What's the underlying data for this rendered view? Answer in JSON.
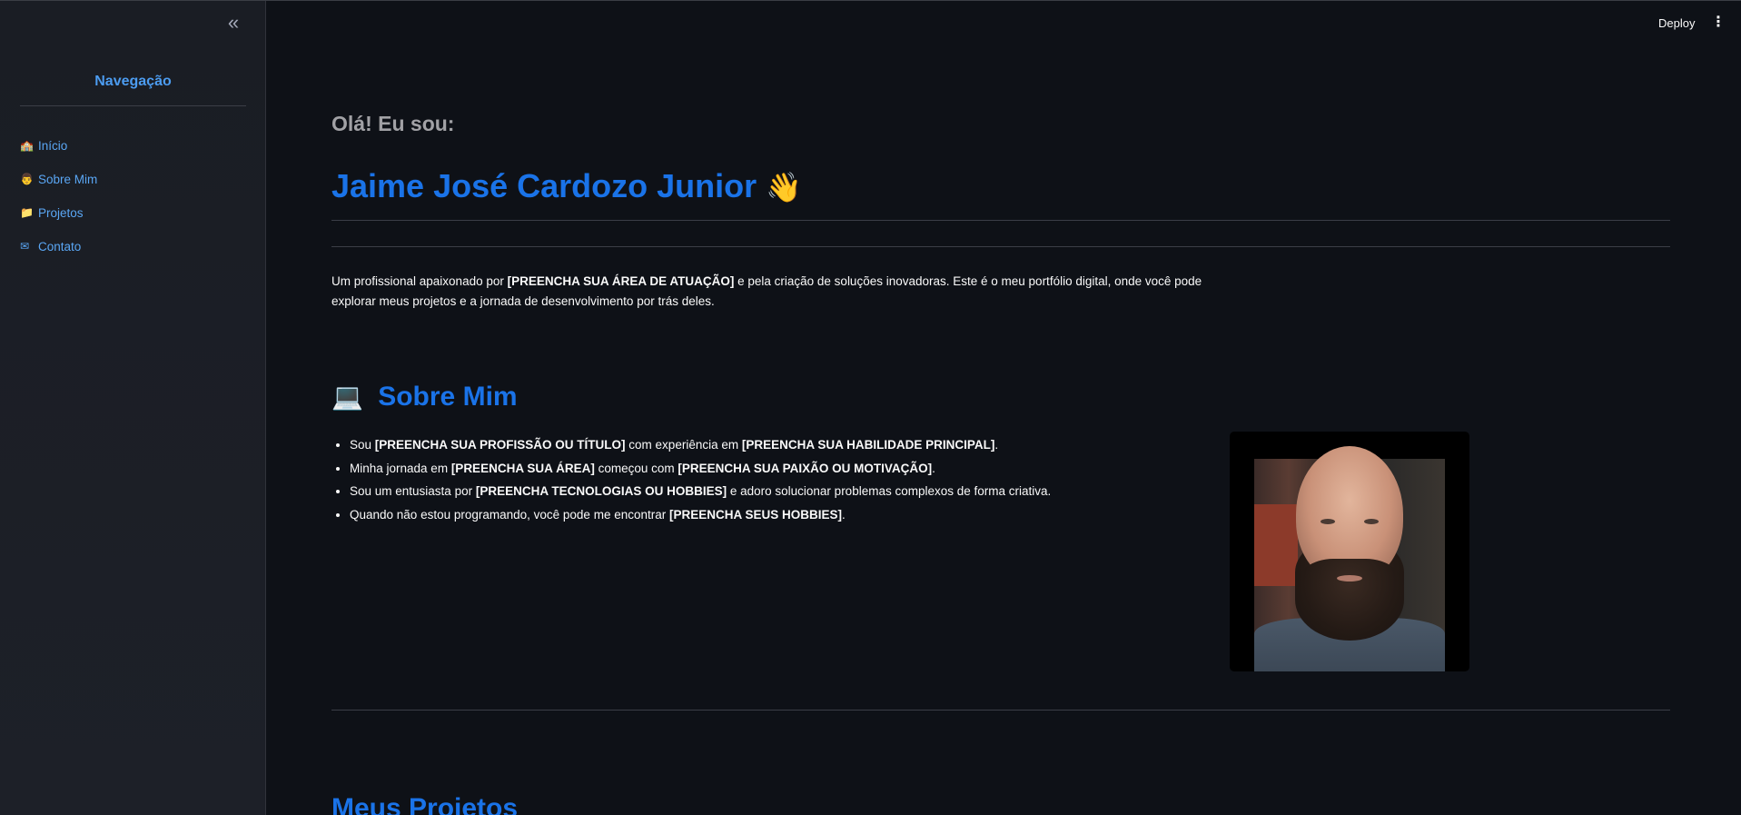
{
  "sidebar": {
    "collapse_icon": "«",
    "title": "Navegação",
    "items": [
      {
        "icon": "🏫",
        "label": "Início"
      },
      {
        "icon": "👨",
        "label": "Sobre Mim"
      },
      {
        "icon": "📁",
        "label": "Projetos"
      },
      {
        "icon": "✉",
        "label": "Contato"
      }
    ]
  },
  "header": {
    "deploy_label": "Deploy",
    "menu_icon": "⋮"
  },
  "hero": {
    "greeting": "Olá! Eu sou:",
    "name": "Jaime José Cardozo Junior",
    "name_emoji": "👋",
    "intro": {
      "p1": "Um profissional apaixonado por ",
      "b1": "[PREENCHA SUA ÁREA DE ATUAÇÃO]",
      "p2": " e pela criação de soluções inovadoras. Este é o meu portfólio digital, onde você pode explorar meus projetos e a jornada de desenvolvimento por trás deles."
    }
  },
  "about": {
    "emoji": "💻",
    "title": "Sobre Mim",
    "bullets": [
      {
        "t1": "Sou ",
        "b1": "[PREENCHA SUA PROFISSÃO OU TÍTULO]",
        "t2": " com experiência em ",
        "b2": "[PREENCHA SUA HABILIDADE PRINCIPAL]",
        "t3": "."
      },
      {
        "t1": "Minha jornada em ",
        "b1": "[PREENCHA SUA ÁREA]",
        "t2": " começou com ",
        "b2": "[PREENCHA SUA PAIXÃO OU MOTIVAÇÃO]",
        "t3": "."
      },
      {
        "t1": "Sou um entusiasta por ",
        "b1": "[PREENCHA TECNOLOGIAS OU HOBBIES]",
        "t2": " e adoro solucionar problemas complexos de forma criativa.",
        "b2": "",
        "t3": ""
      },
      {
        "t1": "Quando não estou programando, você pode me encontrar ",
        "b1": "[PREENCHA SEUS HOBBIES]",
        "t2": ".",
        "b2": "",
        "t3": ""
      }
    ]
  },
  "projects": {
    "title": "Meus Projetos"
  },
  "colors": {
    "background": "#0e1117",
    "sidebar_bg": "#1b1e25",
    "accent": "#1a73e8",
    "link": "#5aa7f5",
    "muted_heading": "#a1a1a5"
  }
}
